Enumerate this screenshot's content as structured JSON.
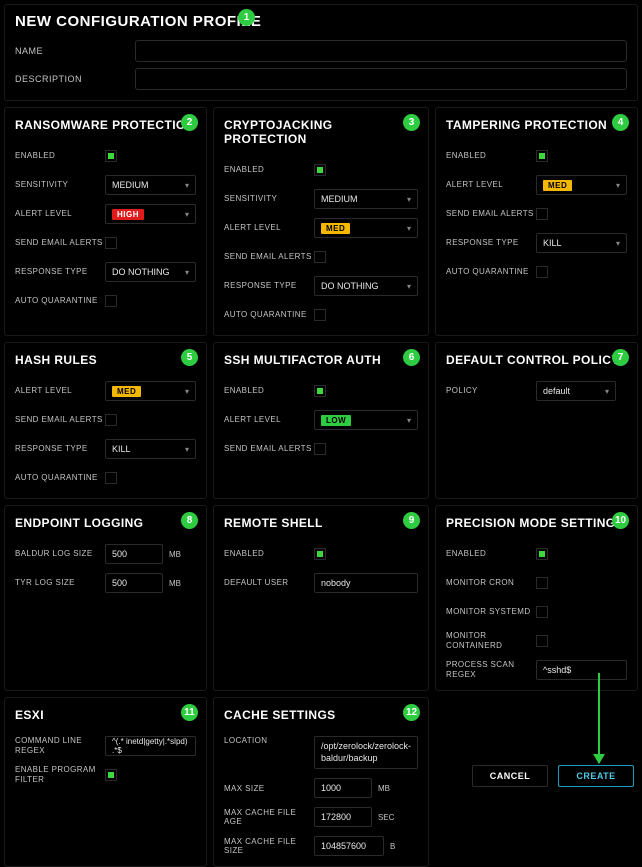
{
  "header": {
    "title": "NEW CONFIGURATION PROFILE",
    "name_label": "NAME",
    "desc_label": "DESCRIPTION"
  },
  "badges": {
    "1": "1",
    "2": "2",
    "3": "3",
    "4": "4",
    "5": "5",
    "6": "6",
    "7": "7",
    "8": "8",
    "9": "9",
    "10": "10",
    "11": "11",
    "12": "12"
  },
  "buttons": {
    "cancel": "CANCEL",
    "create": "CREATE"
  },
  "ransomware": {
    "title": "RANSOMWARE PROTECTION",
    "enabled_label": "ENABLED",
    "sensitivity_label": "SENSITIVITY",
    "sensitivity_value": "MEDIUM",
    "alert_level_label": "ALERT LEVEL",
    "alert_level_value": "HIGH",
    "email_label": "SEND EMAIL ALERTS",
    "response_label": "RESPONSE TYPE",
    "response_value": "DO NOTHING",
    "autoq_label": "AUTO QUARANTINE"
  },
  "crypto": {
    "title": "CRYPTOJACKING PROTECTION",
    "enabled_label": "ENABLED",
    "sensitivity_label": "SENSITIVITY",
    "sensitivity_value": "MEDIUM",
    "alert_level_label": "ALERT LEVEL",
    "alert_level_value": "MED",
    "email_label": "SEND EMAIL ALERTS",
    "response_label": "RESPONSE TYPE",
    "response_value": "DO NOTHING",
    "autoq_label": "AUTO QUARANTINE"
  },
  "tamper": {
    "title": "TAMPERING PROTECTION",
    "enabled_label": "ENABLED",
    "alert_level_label": "ALERT LEVEL",
    "alert_level_value": "MED",
    "email_label": "SEND EMAIL ALERTS",
    "response_label": "RESPONSE TYPE",
    "response_value": "KILL",
    "autoq_label": "AUTO QUARANTINE"
  },
  "hash": {
    "title": "HASH RULES",
    "alert_level_label": "ALERT LEVEL",
    "alert_level_value": "MED",
    "email_label": "SEND EMAIL ALERTS",
    "response_label": "RESPONSE TYPE",
    "response_value": "KILL",
    "autoq_label": "AUTO QUARANTINE"
  },
  "ssh": {
    "title": "SSH MULTIFACTOR AUTH",
    "enabled_label": "ENABLED",
    "alert_level_label": "ALERT LEVEL",
    "alert_level_value": "LOW",
    "email_label": "SEND EMAIL ALERTS"
  },
  "policy": {
    "title": "DEFAULT CONTROL POLICY",
    "policy_label": "POLICY",
    "policy_value": "default"
  },
  "logging": {
    "title": "ENDPOINT LOGGING",
    "baldur_label": "BALDUR LOG SIZE",
    "baldur_value": "500",
    "tyr_label": "TYR LOG SIZE",
    "tyr_value": "500",
    "unit_mb": "MB"
  },
  "shell": {
    "title": "REMOTE SHELL",
    "enabled_label": "ENABLED",
    "user_label": "DEFAULT USER",
    "user_value": "nobody"
  },
  "precision": {
    "title": "PRECISION MODE SETTINGS",
    "enabled_label": "ENABLED",
    "cron_label": "MONITOR CRON",
    "systemd_label": "MONITOR SYSTEMD",
    "containerd_label": "MONITOR CONTAINERD",
    "regex_label": "PROCESS SCAN REGEX",
    "regex_value": "^sshd$"
  },
  "esxi": {
    "title": "ESXI",
    "regex_label": "COMMAND LINE REGEX",
    "regex_value": "^(.* inetd|getty|.*slpd) .*$",
    "filter_label": "ENABLE PROGRAM FILTER"
  },
  "cache": {
    "title": "CACHE SETTINGS",
    "location_label": "LOCATION",
    "location_value": "/opt/zerolock/zerolock-baldur/backup",
    "maxsize_label": "MAX SIZE",
    "maxsize_value": "1000",
    "unit_mb": "MB",
    "maxage_label": "MAX CACHE FILE AGE",
    "maxage_value": "172800",
    "unit_sec": "SEC",
    "maxfile_label": "MAX CACHE FILE SIZE",
    "maxfile_value": "104857600",
    "unit_b": "B"
  }
}
